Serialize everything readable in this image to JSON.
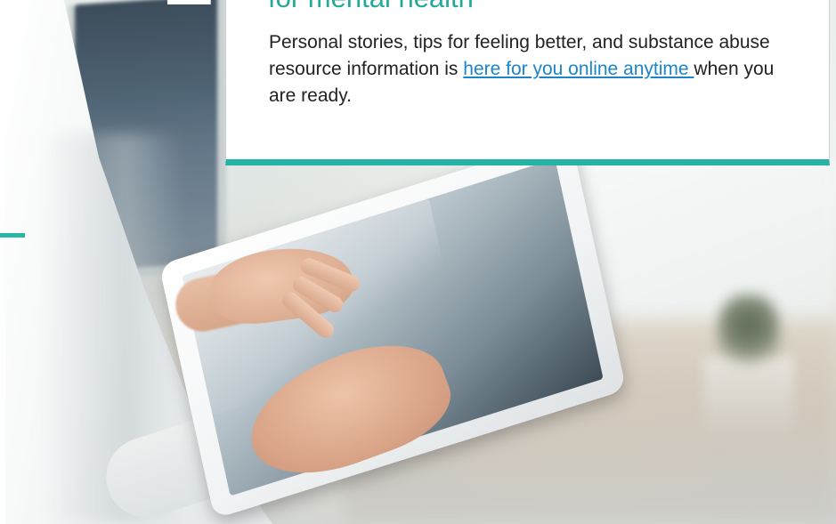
{
  "card": {
    "heading": "for mental health",
    "body_before": "Personal stories, tips for feeling better, and substance abuse resource information is ",
    "link_text": "here for you online anytime ",
    "body_after": "when you are ready."
  },
  "colors": {
    "accent_teal": "#26b3a5",
    "heading_teal": "#23a99a",
    "link_blue": "#1a86c9",
    "body_text": "#222222"
  },
  "hero_image": {
    "icon": "woman-using-tablet-photo"
  }
}
